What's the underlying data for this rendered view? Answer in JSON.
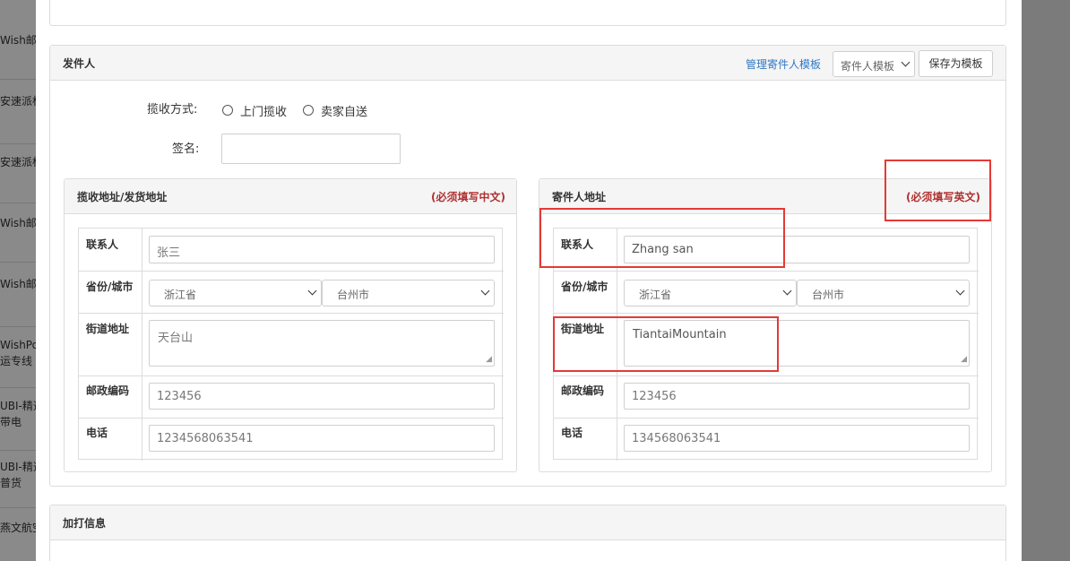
{
  "sidebar": {
    "items": [
      {
        "text": "Wish邮-"
      },
      {
        "text": "安速派标"
      },
      {
        "text": "安速派标"
      },
      {
        "text": "Wish邮-"
      },
      {
        "text": "Wish邮-"
      },
      {
        "text": "WishPos\n运专线"
      },
      {
        "text": "UBI-精选\n带电"
      },
      {
        "text": "UBI-精选\n普货"
      },
      {
        "text": "燕文航空"
      }
    ]
  },
  "sender_section": {
    "title": "发件人",
    "manage_link": "管理寄件人模板",
    "template_select": "寄件人模板",
    "save_template_button": "保存为模板",
    "pickup_label": "揽收方式:",
    "pickup_options": [
      "上门揽收",
      "卖家自送"
    ],
    "signature_label": "签名:",
    "signature_value": ""
  },
  "pickup_address": {
    "title": "揽收地址/发货地址",
    "note": "(必须填写中文)",
    "contact_label": "联系人",
    "contact_value": "张三",
    "province_city_label": "省份/城市",
    "province": "浙江省",
    "city": "台州市",
    "street_label": "街道地址",
    "street_value": "天台山",
    "postcode_label": "邮政编码",
    "postcode_value": "123456",
    "phone_label": "电话",
    "phone_value": "1234568063541"
  },
  "sender_address": {
    "title": "寄件人地址",
    "note": "(必须填写英文)",
    "contact_label": "联系人",
    "contact_value": "Zhang san",
    "province_city_label": "省份/城市",
    "province": "浙江省",
    "city": "台州市",
    "street_label": "街道地址",
    "street_value": "TiantaiMountain",
    "postcode_label": "邮政编码",
    "postcode_value": "123456",
    "phone_label": "电话",
    "phone_value": "134568063541"
  },
  "extra_print": {
    "title": "加打信息"
  },
  "colors": {
    "accent_link": "#2f78c4",
    "note_red": "#b03030",
    "highlight_box": "#e53935"
  }
}
